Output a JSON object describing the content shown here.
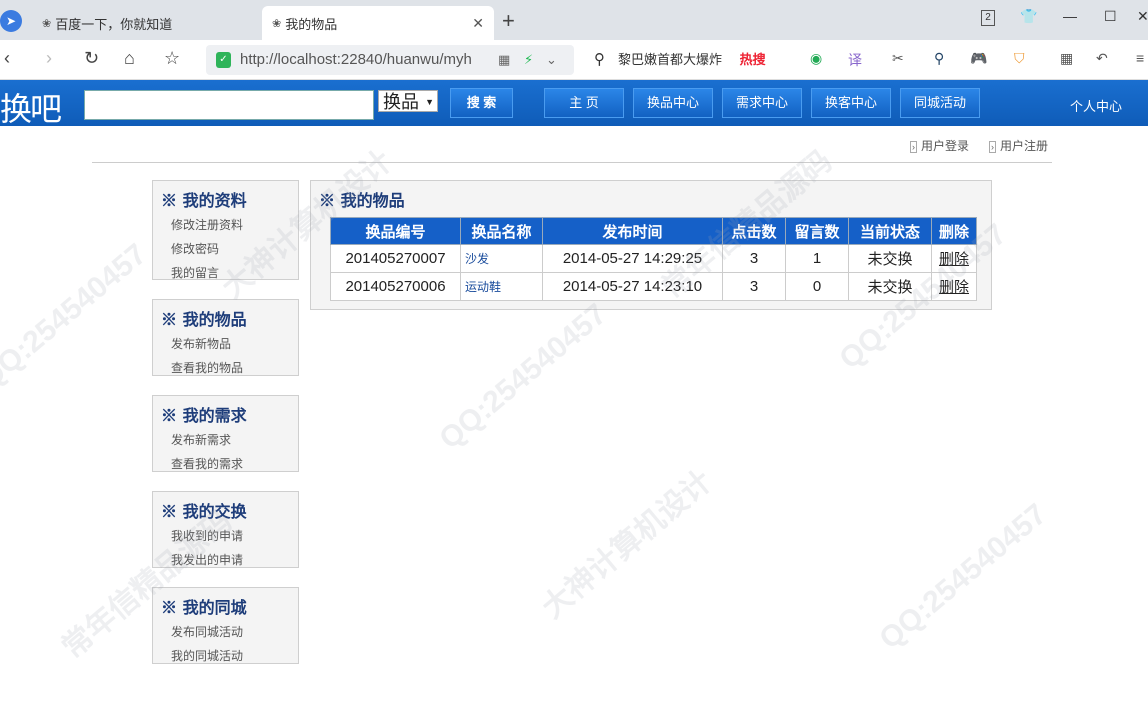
{
  "browser": {
    "tabs": [
      {
        "label": "百度一下，你就知道",
        "active": false
      },
      {
        "label": "我的物品",
        "active": true
      }
    ],
    "new_tab_icon": "+",
    "tab_count_badge": "2",
    "url": "http://localhost:22840/huanwu/myh",
    "search_suggestion": "黎巴嫩首都大爆炸",
    "hot_label": "热搜"
  },
  "site": {
    "logo": "换吧",
    "search_placeholder": "",
    "category_select": "换品",
    "search_button": "搜 索",
    "nav": [
      {
        "label": "主 页"
      },
      {
        "label": "换品中心"
      },
      {
        "label": "需求中心"
      },
      {
        "label": "换客中心"
      },
      {
        "label": "同城活动"
      }
    ],
    "personal_center": "个人中心",
    "login_link": "用户登录",
    "register_link": "用户注册"
  },
  "sidebar": [
    {
      "title": "※ 我的资料",
      "links": [
        "修改注册资料",
        "修改密码",
        "我的留言"
      ]
    },
    {
      "title": "※ 我的物品",
      "links": [
        "发布新物品",
        "查看我的物品"
      ]
    },
    {
      "title": "※ 我的需求",
      "links": [
        "发布新需求",
        "查看我的需求"
      ]
    },
    {
      "title": "※ 我的交换",
      "links": [
        "我收到的申请",
        "我发出的申请"
      ]
    },
    {
      "title": "※ 我的同城",
      "links": [
        "发布同城活动",
        "我的同城活动"
      ]
    }
  ],
  "main": {
    "title": "※ 我的物品",
    "columns": [
      "换品编号",
      "换品名称",
      "发布时间",
      "点击数",
      "留言数",
      "当前状态",
      "删除"
    ],
    "rows": [
      {
        "id": "201405270007",
        "name": "沙发",
        "time": "2014-05-27 14:29:25",
        "clicks": "3",
        "messages": "1",
        "status": "未交换",
        "delete": "删除"
      },
      {
        "id": "201405270006",
        "name": "运动鞋",
        "time": "2014-05-27 14:23:10",
        "clicks": "3",
        "messages": "0",
        "status": "未交换",
        "delete": "删除"
      }
    ]
  },
  "watermarks": [
    "QQ:254540457",
    "常年信精品源码",
    "大神计算机设计"
  ]
}
